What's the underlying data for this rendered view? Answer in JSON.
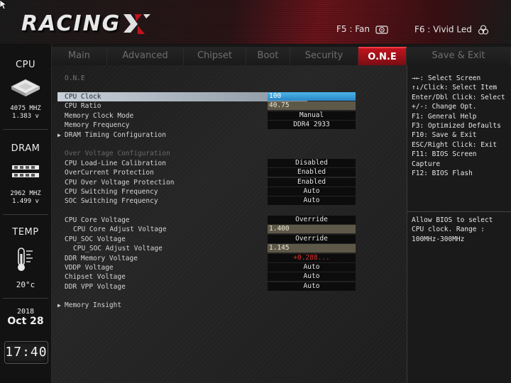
{
  "header": {
    "logo_text": "RACING",
    "hotkeys": [
      {
        "label": "F5 : Fan",
        "icon": "fan-icon"
      },
      {
        "label": "F6 : Vivid Led",
        "icon": "led-icon"
      }
    ],
    "accent": "#c0141e"
  },
  "sidebar": {
    "cpu": {
      "title": "CPU",
      "freq": "4075 MHZ",
      "volt": "1.383 v"
    },
    "dram": {
      "title": "DRAM",
      "freq": "2962 MHZ",
      "volt": "1.499 v"
    },
    "temp": {
      "title": "TEMP",
      "value": "20°c"
    },
    "date": {
      "year": "2018",
      "month_day": "Oct 28"
    },
    "clock": "17:40"
  },
  "tabs": [
    {
      "label": "Main",
      "active": false
    },
    {
      "label": "Advanced",
      "active": false
    },
    {
      "label": "Chipset",
      "active": false
    },
    {
      "label": "Boot",
      "active": false
    },
    {
      "label": "Security",
      "active": false
    },
    {
      "label": "O.N.E",
      "active": true
    },
    {
      "label": "Save & Exit",
      "active": false
    }
  ],
  "main": {
    "page_header": "O.N.E",
    "rows": {
      "cpu_clock": {
        "label": "CPU Clock",
        "value": "100"
      },
      "cpu_ratio": {
        "label": "CPU Ratio",
        "value": "40.75"
      },
      "mem_clock_mode": {
        "label": "Memory Clock Mode",
        "value": "Manual"
      },
      "mem_freq": {
        "label": "Memory Frequency",
        "value": "DDR4 2933"
      },
      "dram_timing": {
        "label": "DRAM Timing Configuration"
      },
      "ov_section": {
        "label": "Over Voltage Configuration"
      },
      "llc": {
        "label": "CPU Load-Line Calibration",
        "value": "Disabled"
      },
      "ocp": {
        "label": "OverCurrent Protection",
        "value": "Enabled"
      },
      "ovp": {
        "label": "CPU Over Voltage Protection",
        "value": "Enabled"
      },
      "cpu_sw_freq": {
        "label": "CPU Switching Frequency",
        "value": "Auto"
      },
      "soc_sw_freq": {
        "label": "SOC Switching Frequency",
        "value": "Auto"
      },
      "cpu_core_v": {
        "label": "CPU Core Voltage",
        "value": "Override"
      },
      "cpu_core_adj": {
        "label": "CPU Core Adjust Voltage",
        "value": "1.400"
      },
      "cpu_soc_v": {
        "label": "CPU_SOC Voltage",
        "value": "Override"
      },
      "cpu_soc_adj": {
        "label": "CPU_SOC Adjust Voltage",
        "value": "1.145"
      },
      "ddr_mem_v": {
        "label": "DDR Memory Voltage",
        "value": "+0.288..."
      },
      "vddp_v": {
        "label": "VDDP Voltage",
        "value": "Auto"
      },
      "chipset_v": {
        "label": "Chipset Voltage",
        "value": "Auto"
      },
      "ddr_vpp_v": {
        "label": "DDR VPP Voltage",
        "value": "Auto"
      },
      "mem_insight": {
        "label": "Memory Insight"
      }
    }
  },
  "help": {
    "keys": [
      "→←: Select Screen",
      "↑↓/Click: Select Item",
      "Enter/Dbl Click: Select",
      "+/-: Change Opt.",
      "F1: General Help",
      "F3: Optimized Defaults",
      "F10: Save & Exit",
      "ESC/Right Click: Exit",
      "F11: BIOS Screen",
      "Capture",
      "F12: BIOS Flash"
    ],
    "description": [
      "Allow BIOS to select",
      "CPU clock. Range :",
      "100MHz-300MHz"
    ]
  }
}
